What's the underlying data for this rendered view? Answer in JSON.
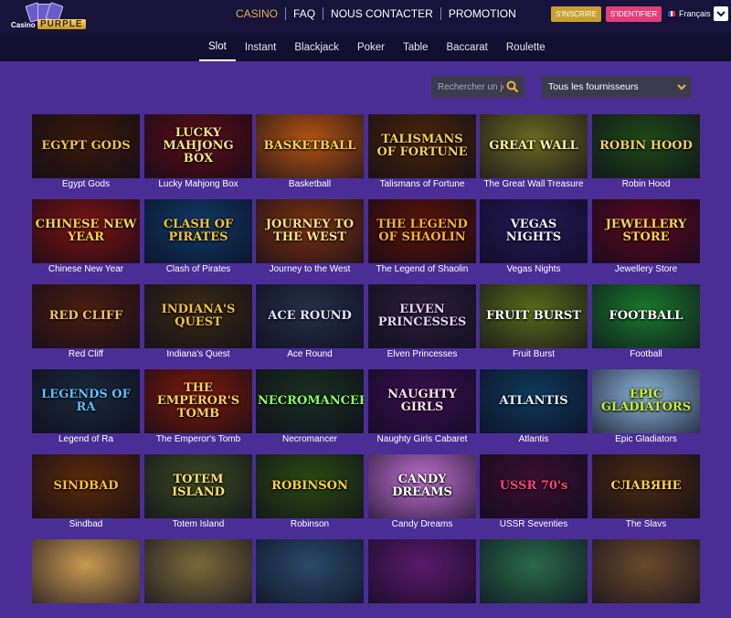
{
  "header": {
    "logo": {
      "word1": "Casino",
      "word2": "PURPLE"
    },
    "nav": [
      {
        "label": "CASINO",
        "active": true
      },
      {
        "label": "FAQ",
        "active": false
      },
      {
        "label": "NOUS CONTACTER",
        "active": false
      },
      {
        "label": "PROMOTION",
        "active": false
      }
    ],
    "register_label": "S'INSCRIRE",
    "login_label": "S'IDENTIFIER",
    "language": "Français",
    "colors": {
      "bar": "#17133a",
      "active_nav": "#e8b04a",
      "register": "#c8a032",
      "login": "#e23e7a"
    }
  },
  "categories": [
    {
      "label": "Slot",
      "active": true
    },
    {
      "label": "Instant",
      "active": false
    },
    {
      "label": "Blackjack",
      "active": false
    },
    {
      "label": "Poker",
      "active": false
    },
    {
      "label": "Table",
      "active": false
    },
    {
      "label": "Baccarat",
      "active": false
    },
    {
      "label": "Roulette",
      "active": false
    }
  ],
  "search": {
    "placeholder": "Rechercher un jeu",
    "icon": "search-icon"
  },
  "provider": {
    "selected": "Tous les fournisseurs",
    "icon": "chevron-down-icon"
  },
  "games": [
    {
      "name": "Egypt Gods",
      "art": "EGYPT GODS",
      "bg": "#3a1a08",
      "fg": "#f2c33c"
    },
    {
      "name": "Lucky Mahjong Box",
      "art": "LUCKY MAHJONG BOX",
      "bg": "#5a0f14",
      "fg": "#f7e08a"
    },
    {
      "name": "Basketball",
      "art": "BASKETBALL",
      "bg": "#b35410",
      "fg": "#ffd24a"
    },
    {
      "name": "Talismans of Fortune",
      "art": "TALISMANS OF FORTUNE",
      "bg": "#4a2608",
      "fg": "#f6cf5a"
    },
    {
      "name": "The Great Wall Treasure",
      "art": "GREAT WALL",
      "bg": "#6a6a20",
      "fg": "#fff2a0"
    },
    {
      "name": "Robin Hood",
      "art": "ROBIN HOOD",
      "bg": "#1e4a16",
      "fg": "#f0d060"
    },
    {
      "name": "Chinese New Year",
      "art": "CHINESE NEW YEAR",
      "bg": "#7a1410",
      "fg": "#ffd050"
    },
    {
      "name": "Clash of Pirates",
      "art": "CLASH OF PIRATES",
      "bg": "#0f3b66",
      "fg": "#f4c23a"
    },
    {
      "name": "Journey to the West",
      "art": "JOURNEY TO THE WEST",
      "bg": "#7a3210",
      "fg": "#ffe080"
    },
    {
      "name": "The Legend of Shaolin",
      "art": "THE LEGEND OF SHAOLIN",
      "bg": "#5a1406",
      "fg": "#ffb030"
    },
    {
      "name": "Vegas Nights",
      "art": "VEGAS NIGHTS",
      "bg": "#251a58",
      "fg": "#f0f0ff"
    },
    {
      "name": "Jewellery Store",
      "art": "JEWELLERY STORE",
      "bg": "#5a0a20",
      "fg": "#ffd24a"
    },
    {
      "name": "Red Cliff",
      "art": "RED CLIFF",
      "bg": "#4a1e10",
      "fg": "#f4c060"
    },
    {
      "name": "Indiana's Quest",
      "art": "INDIANA'S QUEST",
      "bg": "#3a2a14",
      "fg": "#f2c040"
    },
    {
      "name": "Ace Round",
      "art": "ACE ROUND",
      "bg": "#243048",
      "fg": "#e0e8ff"
    },
    {
      "name": "Elven Princesses",
      "art": "ELVEN PRINCESSES",
      "bg": "#2a2038",
      "fg": "#e8d0ff"
    },
    {
      "name": "Fruit Burst",
      "art": "FRUIT BURST",
      "bg": "#5a6a18",
      "fg": "#ffffff"
    },
    {
      "name": "Football",
      "art": "FOOTBALL",
      "bg": "#1a7a2a",
      "fg": "#ffffff"
    },
    {
      "name": "Legend of Ra",
      "art": "LEGENDS OF RA",
      "bg": "#1a2a3a",
      "fg": "#5cc0ff"
    },
    {
      "name": "The Emperor's Tomb",
      "art": "THE EMPEROR'S TOMB",
      "bg": "#7a1a08",
      "fg": "#ffd050"
    },
    {
      "name": "Necromancer",
      "art": "NECROMANCER",
      "bg": "#1a3020",
      "fg": "#8aff60"
    },
    {
      "name": "Naughty Girls Cabaret",
      "art": "NAUGHTY GIRLS",
      "bg": "#3a1050",
      "fg": "#ffe0f0"
    },
    {
      "name": "Atlantis",
      "art": "ATLANTIS",
      "bg": "#0e3a5a",
      "fg": "#e0f0ff"
    },
    {
      "name": "Epic Gladiators",
      "art": "EPIC GLADIATORS",
      "bg": "#8ab4d8",
      "fg": "#c8f030"
    },
    {
      "name": "Sindbad",
      "art": "SINDBAD",
      "bg": "#5a2a08",
      "fg": "#ffc030"
    },
    {
      "name": "Totem Island",
      "art": "TOTEM ISLAND",
      "bg": "#3a4a20",
      "fg": "#ffe070"
    },
    {
      "name": "Robinson",
      "art": "ROBINSON",
      "bg": "#2a4a10",
      "fg": "#ffd040"
    },
    {
      "name": "Candy Dreams",
      "art": "CANDY DREAMS",
      "bg": "#c070d0",
      "fg": "#ffffff"
    },
    {
      "name": "USSR Seventies",
      "art": "USSR 70's",
      "bg": "#3a1030",
      "fg": "#ff4080"
    },
    {
      "name": "The Slavs",
      "art": "СЛАВЯНЕ",
      "bg": "#4a2a10",
      "fg": "#ffd050"
    },
    {
      "name": "",
      "art": "",
      "bg": "#c89a50",
      "fg": "#ffffff"
    },
    {
      "name": "",
      "art": "",
      "bg": "#7a6a3a",
      "fg": "#ffffff"
    },
    {
      "name": "",
      "art": "",
      "bg": "#2a4a6a",
      "fg": "#ffffff"
    },
    {
      "name": "",
      "art": "",
      "bg": "#5a1a6a",
      "fg": "#ffffff"
    },
    {
      "name": "",
      "art": "",
      "bg": "#2a6a4a",
      "fg": "#ffffff"
    },
    {
      "name": "",
      "art": "",
      "bg": "#6a4a2a",
      "fg": "#ffffff"
    }
  ]
}
